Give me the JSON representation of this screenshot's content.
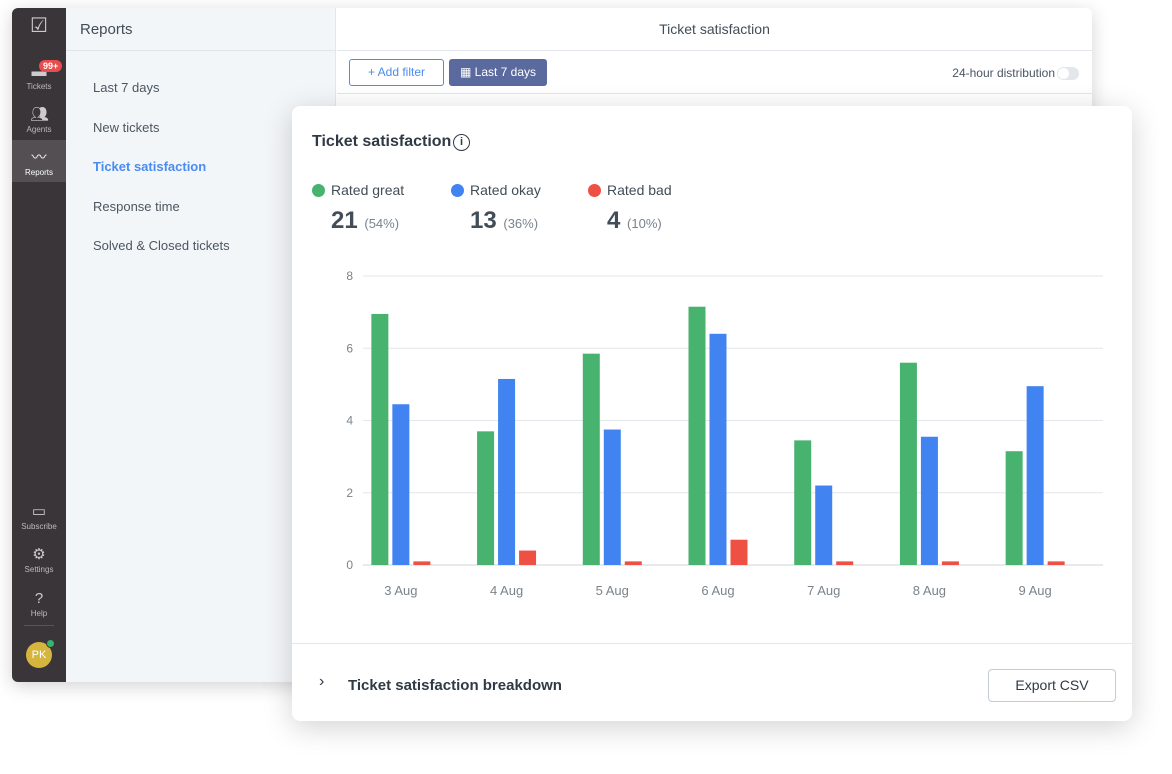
{
  "rail": {
    "items": [
      {
        "label": "Tickets",
        "badge": "99+"
      },
      {
        "label": "Agents"
      },
      {
        "label": "Reports"
      },
      {
        "label": "Subscribe"
      },
      {
        "label": "Settings"
      },
      {
        "label": "Help"
      }
    ],
    "avatar": "PK"
  },
  "sidebar": {
    "title": "Reports",
    "items": [
      "Last 7 days",
      "New tickets",
      "Ticket satisfaction",
      "Response time",
      "Solved & Closed tickets"
    ],
    "selected": "Ticket satisfaction"
  },
  "header": {
    "title": "Ticket satisfaction"
  },
  "toolbar": {
    "add_filter": "+ Add filter",
    "date_range": "Last 7 days",
    "distribution_label": "24-hour distribution",
    "distribution_on": false
  },
  "card": {
    "title": "Ticket satisfaction",
    "legend": [
      {
        "label": "Rated great",
        "count": "21",
        "pct": "(54%)",
        "color": "#48b26f"
      },
      {
        "label": "Rated okay",
        "count": "13",
        "pct": "(36%)",
        "color": "#4183f0"
      },
      {
        "label": "Rated bad",
        "count": "4",
        "pct": "(10%)",
        "color": "#ef5044"
      }
    ],
    "breakdown": "Ticket satisfaction breakdown",
    "export": "Export CSV"
  },
  "chart_data": {
    "type": "bar",
    "categories": [
      "3 Aug",
      "4 Aug",
      "5 Aug",
      "6 Aug",
      "7 Aug",
      "8 Aug",
      "9 Aug"
    ],
    "series": [
      {
        "name": "Rated great",
        "color": "#48b26f",
        "values": [
          6.95,
          3.7,
          5.85,
          7.15,
          3.45,
          5.6,
          3.15
        ]
      },
      {
        "name": "Rated okay",
        "color": "#4183f0",
        "values": [
          4.45,
          5.15,
          3.75,
          6.4,
          2.2,
          3.55,
          4.95
        ]
      },
      {
        "name": "Rated bad",
        "color": "#ef5044",
        "values": [
          0.1,
          0.4,
          0.1,
          0.7,
          0.1,
          0.1,
          0.1
        ]
      }
    ],
    "yticks": [
      0,
      2,
      4,
      6,
      8
    ],
    "ylim": [
      0,
      8
    ],
    "grid": true
  }
}
